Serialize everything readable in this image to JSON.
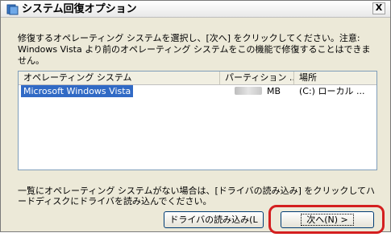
{
  "window": {
    "title": "システム回復オプション",
    "close_label": "X"
  },
  "description": "修復するオペレーティング システムを選択し、[次へ] をクリックしてください。注意: Windows Vista より前のオペレーティング システムをこの機能で修復することはできません。",
  "os_list": {
    "columns": [
      "オペレーティング システム",
      "パーティション ...",
      "場所"
    ],
    "rows": [
      {
        "os": "Microsoft Windows Vista",
        "partition": "MB",
        "location": "(C:) ローカル ..."
      }
    ]
  },
  "note": "一覧にオペレーティング システムがない場合は、[ドライバの読み込み] をクリックしてハードディスクにドライバを読み込んでください。",
  "buttons": {
    "load_drivers": "ドライバの読み込み(L",
    "next": "次へ(N) >"
  },
  "colors": {
    "selection": "#316ac5",
    "highlight_ring": "#d41f1f"
  }
}
